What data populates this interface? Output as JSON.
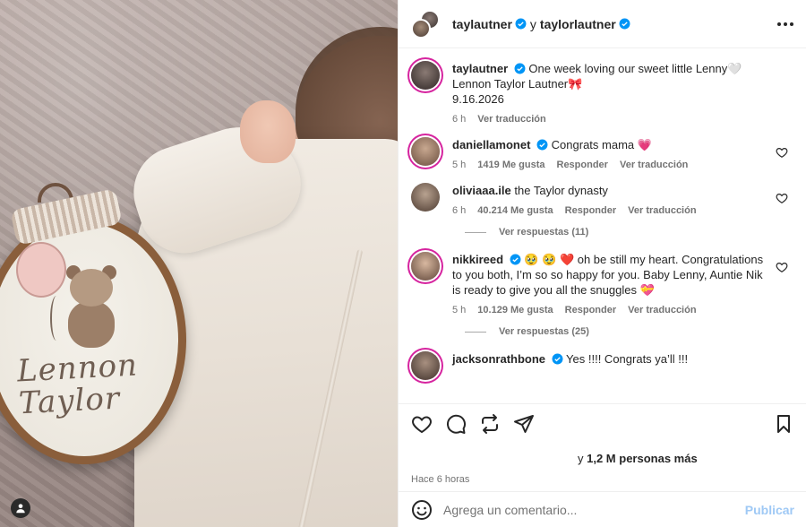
{
  "header": {
    "user1": "taylautner",
    "conj": "y",
    "user2": "taylorlautner"
  },
  "caption": {
    "user": "taylautner",
    "line1": "One week loving our sweet little Lenny🤍",
    "line2": "Lennon Taylor Lautner🎀",
    "line3": "9.16.2026",
    "time": "6 h",
    "translate": "Ver traducción"
  },
  "comments": [
    {
      "user": "daniellamonet",
      "text": "Congrats mama 💗",
      "time": "5 h",
      "likes": "1419 Me gusta",
      "reply": "Responder",
      "translate": "Ver traducción"
    },
    {
      "user": "oliviaaa.ile",
      "text": "the Taylor dynasty",
      "time": "6 h",
      "likes": "40.214 Me gusta",
      "reply": "Responder",
      "translate": "Ver traducción",
      "view_replies": "Ver respuestas (11)"
    },
    {
      "user": "nikkireed",
      "text": "🥹 🥹 ❤️  oh be still my heart. Congratulations to you both, I’m so so happy for you. Baby Lenny, Auntie Nik is ready to give you all the snuggles 💝",
      "time": "5 h",
      "likes": "10.129 Me gusta",
      "reply": "Responder",
      "translate": "Ver traducción",
      "view_replies": "Ver respuestas (25)"
    },
    {
      "user": "jacksonrathbone",
      "text": "Yes !!!! Congrats ya’ll !!!"
    }
  ],
  "likes": {
    "prefix": "y",
    "count": "1,2 M personas más"
  },
  "time_ago": "Hace 6 horas",
  "add_comment": {
    "placeholder": "Agrega un comentario...",
    "publish": "Publicar"
  },
  "photo": {
    "embroidery_line1": "Lennon",
    "embroidery_line2": "Taylor"
  },
  "colors": {
    "verified": "#0095f6",
    "publish": "#9fc9f5",
    "muted": "#737373"
  }
}
